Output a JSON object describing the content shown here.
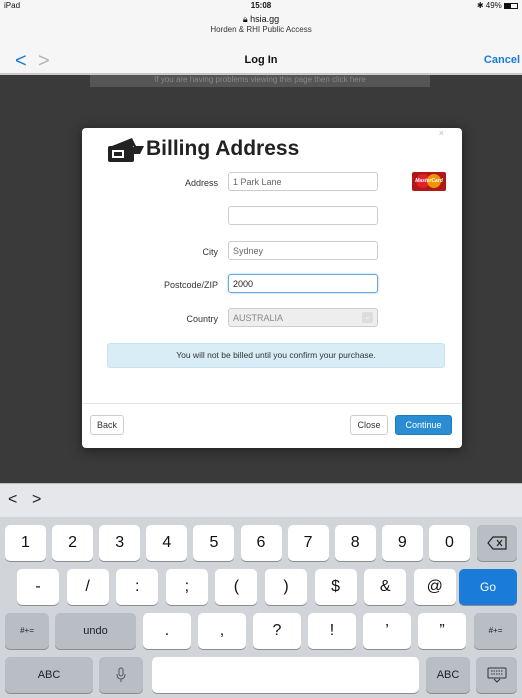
{
  "status_bar": {
    "device": "iPad",
    "time": "15:08",
    "battery": "49%"
  },
  "browser": {
    "domain": "hsia.gg",
    "site_info": "Horden & RHI Public Access",
    "title": "Log In",
    "cancel_label": "Cancel",
    "back_glyph": "<",
    "forward_glyph": ">"
  },
  "page": {
    "notice_text": "If you are having problems viewing this page then click here"
  },
  "modal": {
    "close_glyph": "×",
    "title": "Billing Address",
    "header_icon": "wallet-icon",
    "card_icon": "mastercard-icon",
    "card_label": "MasterCard",
    "fields": {
      "address_label": "Address",
      "address_value": "1 Park Lane",
      "address2_value": "",
      "city_label": "City",
      "city_value": "Sydney",
      "postcode_label": "Postcode/ZIP",
      "postcode_value": "2000",
      "country_label": "Country",
      "country_value": "AUSTRALIA",
      "country_arrow": "⌄"
    },
    "info_text": "You will not be billed until you confirm your purchase.",
    "buttons": {
      "back": "Back",
      "close": "Close",
      "continue": "Continue"
    }
  },
  "keyboard": {
    "toolbar_prev": "<",
    "toolbar_next": ">",
    "row1": [
      "1",
      "2",
      "3",
      "4",
      "5",
      "6",
      "7",
      "8",
      "9",
      "0"
    ],
    "row1_delete_icon": "delete-icon",
    "row2": [
      "-",
      "/",
      ":",
      ";",
      "(",
      ")",
      "$",
      "&",
      "@"
    ],
    "row2_go": "Go",
    "row3_shift_left": "#+=",
    "row3_undo": "undo",
    "row3": [
      ".",
      ",",
      "?",
      "!",
      "’",
      "”"
    ],
    "row3_shift_right": "#+=",
    "row4_abc_left": "ABC",
    "row4_mic_icon": "microphone-icon",
    "row4_abc_right": "ABC",
    "row4_hide_icon": "keyboard-hide-icon"
  },
  "colors": {
    "accent": "#1a7bd8",
    "info_bg": "#d8edf6",
    "primary_button": "#2a8dd4"
  }
}
